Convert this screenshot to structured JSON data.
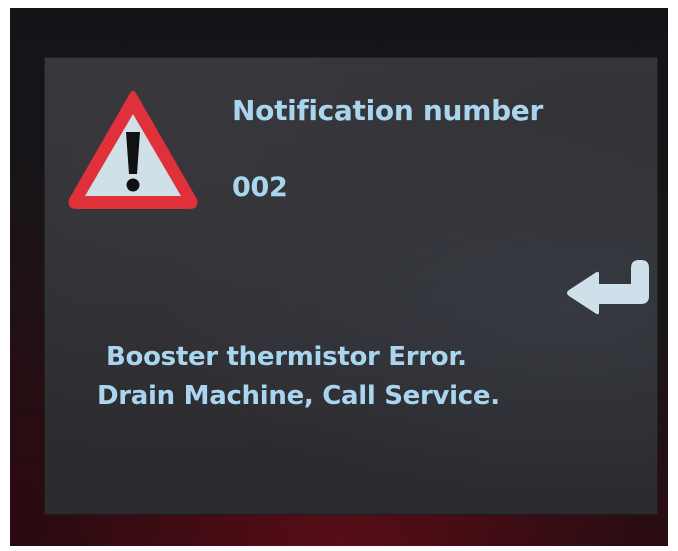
{
  "notification": {
    "label": "Notification number",
    "number": "002"
  },
  "message": {
    "line1": "Booster thermistor Error.",
    "line2": "Drain Machine, Call Service."
  },
  "icons": {
    "warning": "warning-triangle-icon",
    "confirm": "enter-return-arrow-icon"
  },
  "colors": {
    "text": "#a9d6ee",
    "warning_red": "#e0303a",
    "warning_fill": "#cfe0e6",
    "screen_bg": "#303034"
  }
}
